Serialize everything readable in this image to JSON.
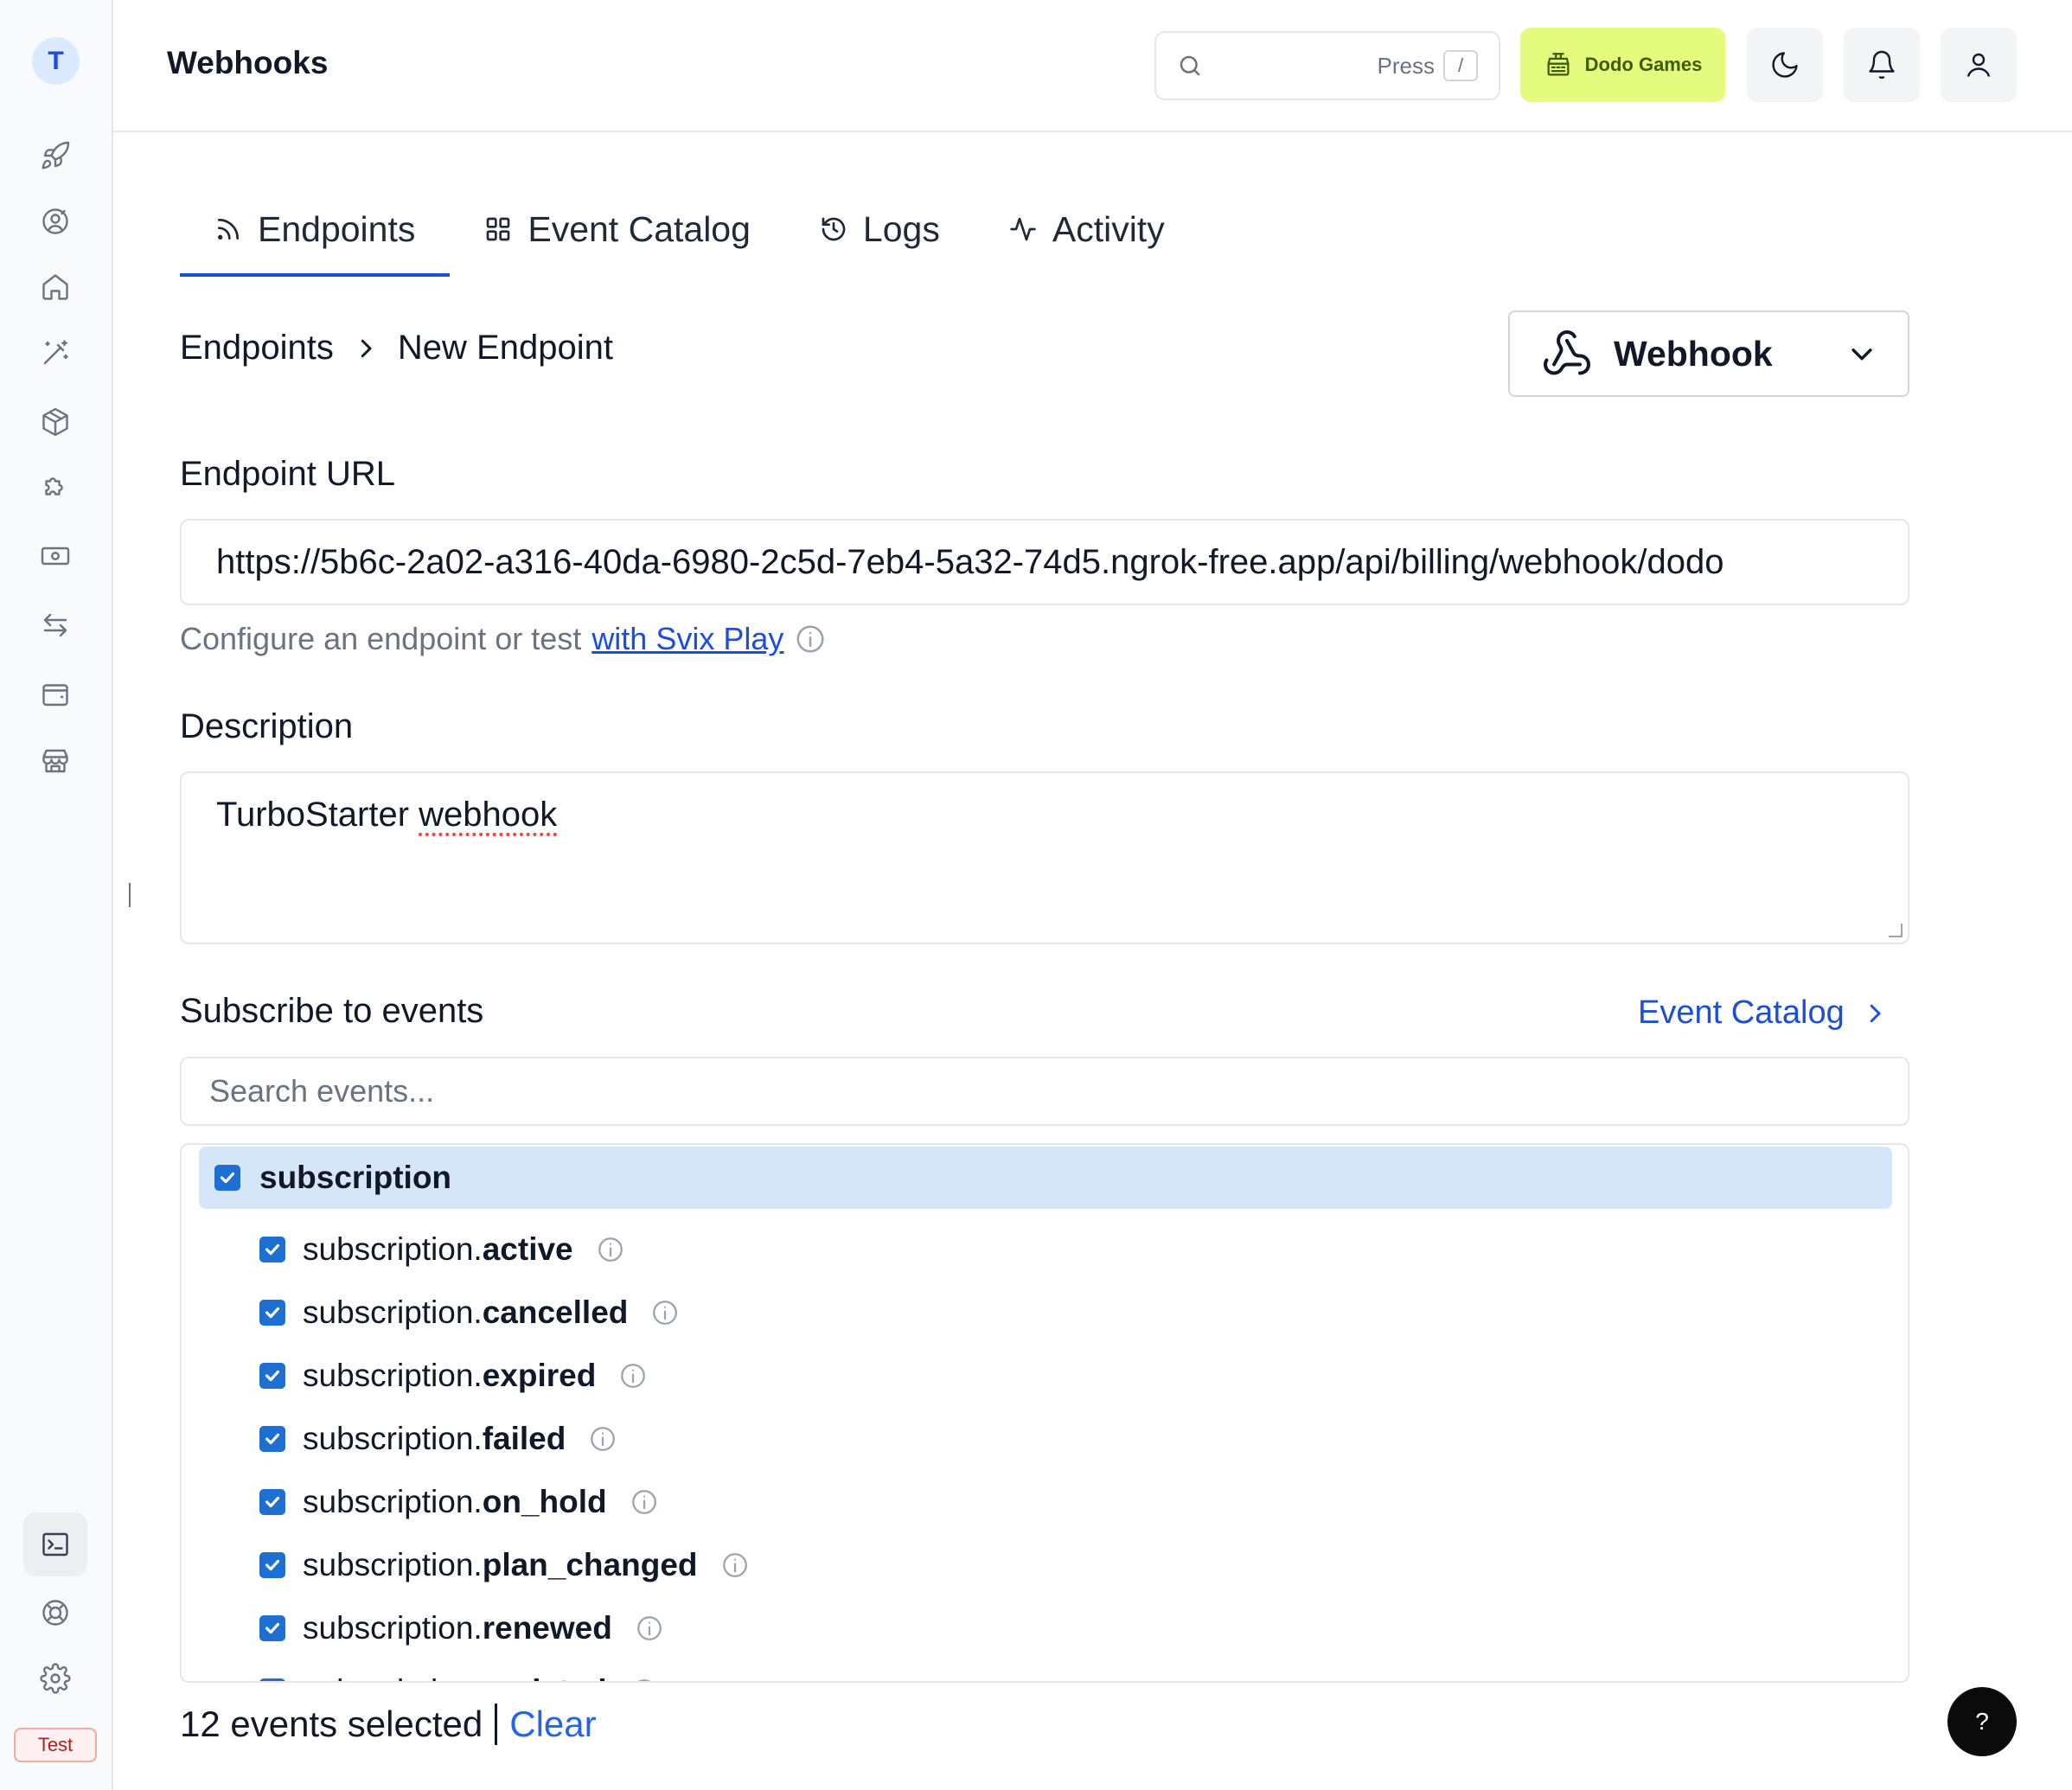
{
  "sidebar": {
    "avatar_letter": "T",
    "env_badge": "Test"
  },
  "header": {
    "title": "Webhooks",
    "search_hint": "Press",
    "search_shortcut": "/",
    "business_name": "Dodo Games"
  },
  "tabs": [
    {
      "label": "Endpoints",
      "icon": "rss-icon",
      "active": true
    },
    {
      "label": "Event Catalog",
      "icon": "grid-icon",
      "active": false
    },
    {
      "label": "Logs",
      "icon": "history-icon",
      "active": false
    },
    {
      "label": "Activity",
      "icon": "activity-icon",
      "active": false
    }
  ],
  "breadcrumb": {
    "parent": "Endpoints",
    "current": "New Endpoint"
  },
  "endpoint_type": {
    "selected": "Webhook"
  },
  "form": {
    "url_label": "Endpoint URL",
    "url_value": "https://5b6c-2a02-a316-40da-6980-2c5d-7eb4-5a32-74d5.ngrok-free.app/api/billing/webhook/dodo",
    "hint_text": "Configure an endpoint or test",
    "hint_link": "with Svix Play",
    "description_label": "Description",
    "description_word1": "TurboStarter",
    "description_word2": "webhook"
  },
  "events": {
    "title": "Subscribe to events",
    "catalog_link": "Event Catalog",
    "search_placeholder": "Search events...",
    "group": "subscription",
    "items": [
      {
        "prefix": "subscription.",
        "name": "active"
      },
      {
        "prefix": "subscription.",
        "name": "cancelled"
      },
      {
        "prefix": "subscription.",
        "name": "expired"
      },
      {
        "prefix": "subscription.",
        "name": "failed"
      },
      {
        "prefix": "subscription.",
        "name": "on_hold"
      },
      {
        "prefix": "subscription.",
        "name": "plan_changed"
      },
      {
        "prefix": "subscription.",
        "name": "renewed"
      },
      {
        "prefix": "subscription.",
        "name": "updated"
      }
    ],
    "selected_count": "12 events selected",
    "clear_label": "Clear"
  },
  "help_button": "?",
  "colors": {
    "accent": "#1d4ed8",
    "brand_button": "#e4fb7d",
    "selected_group": "#d6e6f9"
  }
}
